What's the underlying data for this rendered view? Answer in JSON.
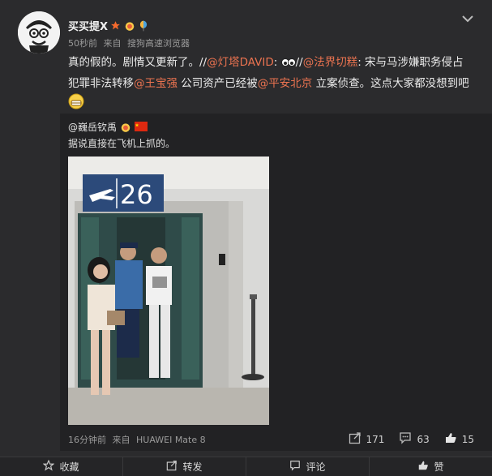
{
  "post": {
    "username": "买买提X",
    "time": "50秒前",
    "via_label": "来自",
    "source": "搜狗高速浏览器",
    "text_segments": [
      {
        "t": "真的假的。剧情又更新了。//",
        "m": false
      },
      {
        "t": "@灯塔DAVID",
        "m": true
      },
      {
        "t": ": ",
        "m": false
      },
      {
        "t": "//",
        "m": false
      },
      {
        "t": "@法界切糕",
        "m": true
      },
      {
        "t": ": 宋与马涉嫌职务侵占犯罪非法转移",
        "m": false
      },
      {
        "t": "@王宝强",
        "m": true
      },
      {
        "t": " 公司资产已经被",
        "m": false
      },
      {
        "t": "@平安北京",
        "m": true
      },
      {
        "t": " 立案侦查。这点大家都没想到吧",
        "m": false
      }
    ]
  },
  "repost": {
    "author": "@巍岳钦禹",
    "text": "据说直接在飞机上抓的。",
    "gate_number": "26",
    "time": "16分钟前",
    "via_label": "来自",
    "source": "HUAWEI Mate 8",
    "shares": "171",
    "comments": "63",
    "likes": "15"
  },
  "actions": {
    "favorite": "收藏",
    "repost": "转发",
    "comment": "评论",
    "like": "赞"
  },
  "colors": {
    "mention": "#eb7350",
    "background": "#2b2b2d"
  },
  "icons": [
    "chevron-down-icon",
    "share-icon",
    "comment-icon",
    "like-icon",
    "star-icon",
    "repost-icon"
  ]
}
